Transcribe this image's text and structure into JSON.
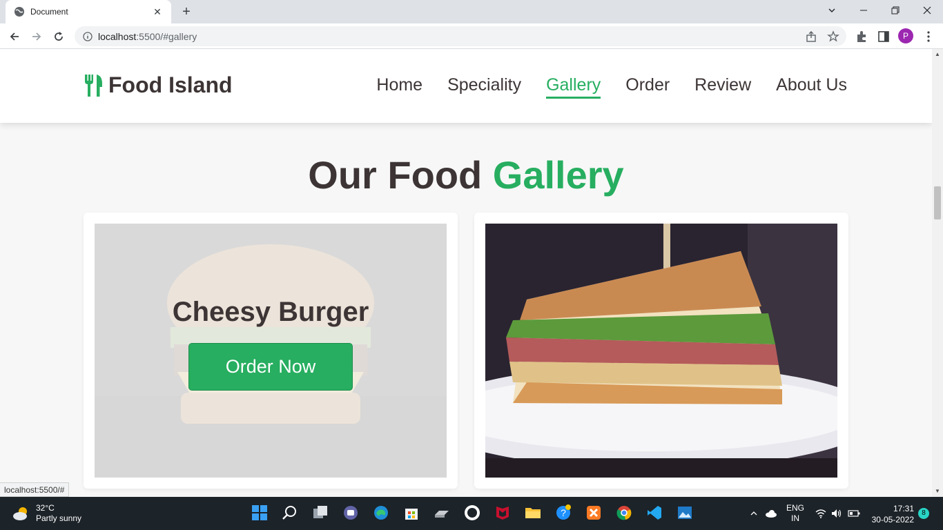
{
  "browser": {
    "tab_title": "Document",
    "url_host": "localhost",
    "url_rest": ":5500/#gallery",
    "profile_initial": "P",
    "status_url": "localhost:5500/#"
  },
  "site": {
    "logo_text": "Food Island",
    "nav": [
      {
        "label": "Home",
        "active": false
      },
      {
        "label": "Speciality",
        "active": false
      },
      {
        "label": "Gallery",
        "active": true
      },
      {
        "label": "Order",
        "active": false
      },
      {
        "label": "Review",
        "active": false
      },
      {
        "label": "About Us",
        "active": false
      }
    ],
    "section_title_main": "Our Food",
    "section_title_accent": "Gallery",
    "cards": [
      {
        "name": "Cheesy Burger",
        "button": "Order Now",
        "image": "burger-photo"
      },
      {
        "image": "sandwich-photo"
      }
    ]
  },
  "taskbar": {
    "temperature": "32°C",
    "weather": "Partly sunny",
    "language": "ENG",
    "region": "IN",
    "time": "17:31",
    "date": "30-05-2022",
    "notifications": "8"
  },
  "colors": {
    "accent": "#27ae60",
    "heading": "#3d3535",
    "taskbar": "#1c2329"
  }
}
